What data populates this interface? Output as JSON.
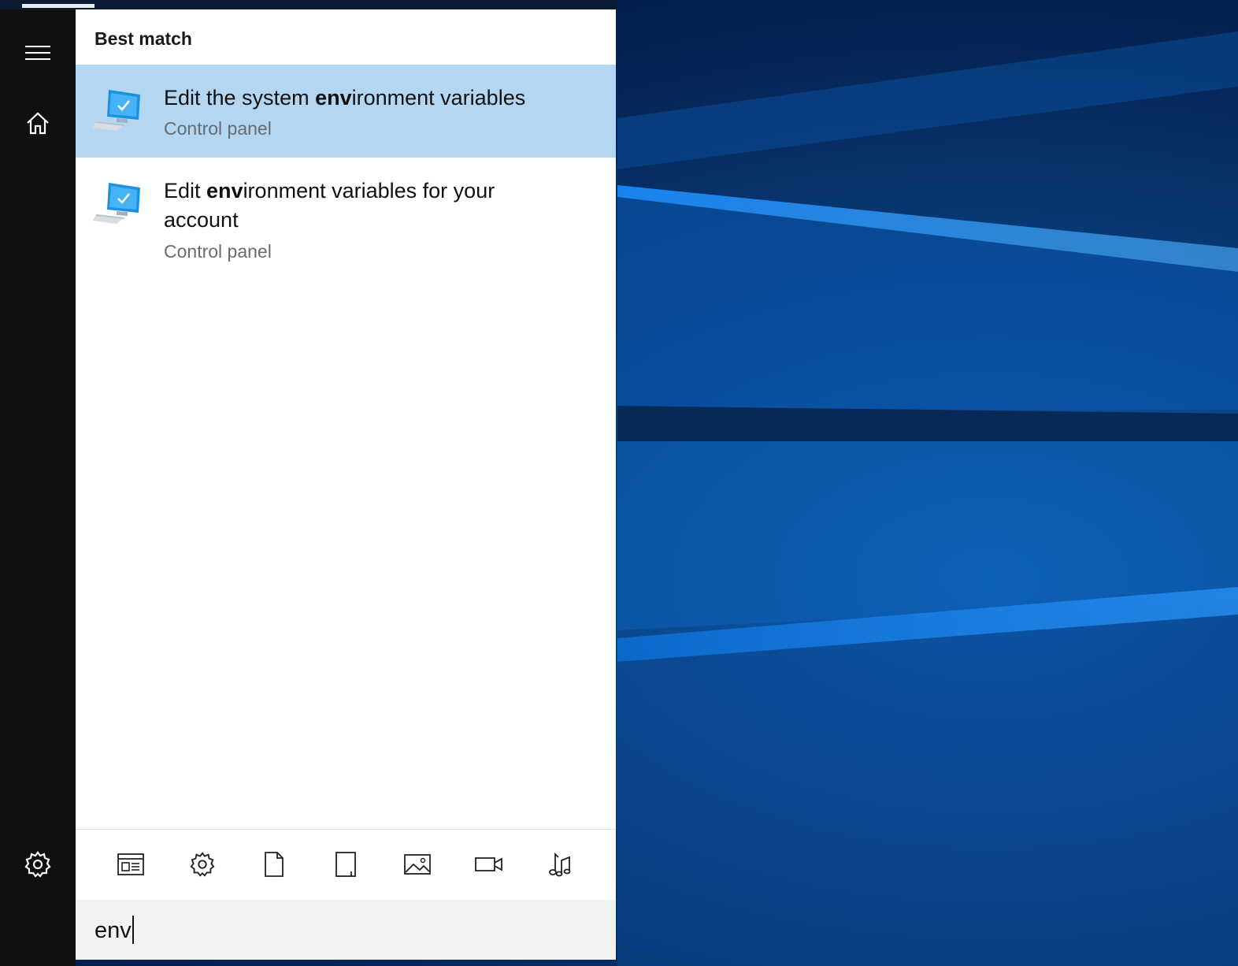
{
  "sidebar": {
    "menu_icon": "hamburger-menu-icon",
    "home_icon": "home-icon",
    "settings_icon": "gear-icon"
  },
  "results": {
    "section_title": "Best match",
    "items": [
      {
        "title_prefix": "Edit the system ",
        "title_match": "env",
        "title_suffix": "ironment variables",
        "subtitle": "Control panel",
        "icon": "control-panel-computer-icon",
        "selected": true
      },
      {
        "title_prefix": "Edit ",
        "title_match": "env",
        "title_suffix": "ironment variables for your account",
        "subtitle": "Control panel",
        "icon": "control-panel-computer-icon",
        "selected": false
      }
    ]
  },
  "filters": [
    {
      "icon": "apps-icon"
    },
    {
      "icon": "settings-gear-icon"
    },
    {
      "icon": "document-icon"
    },
    {
      "icon": "folder-icon"
    },
    {
      "icon": "photo-icon"
    },
    {
      "icon": "video-icon"
    },
    {
      "icon": "music-icon"
    }
  ],
  "search": {
    "value": "env"
  },
  "colors": {
    "selected_bg": "#b3d6f2",
    "rail_bg": "#101010",
    "search_bg": "#f2f2f2"
  }
}
